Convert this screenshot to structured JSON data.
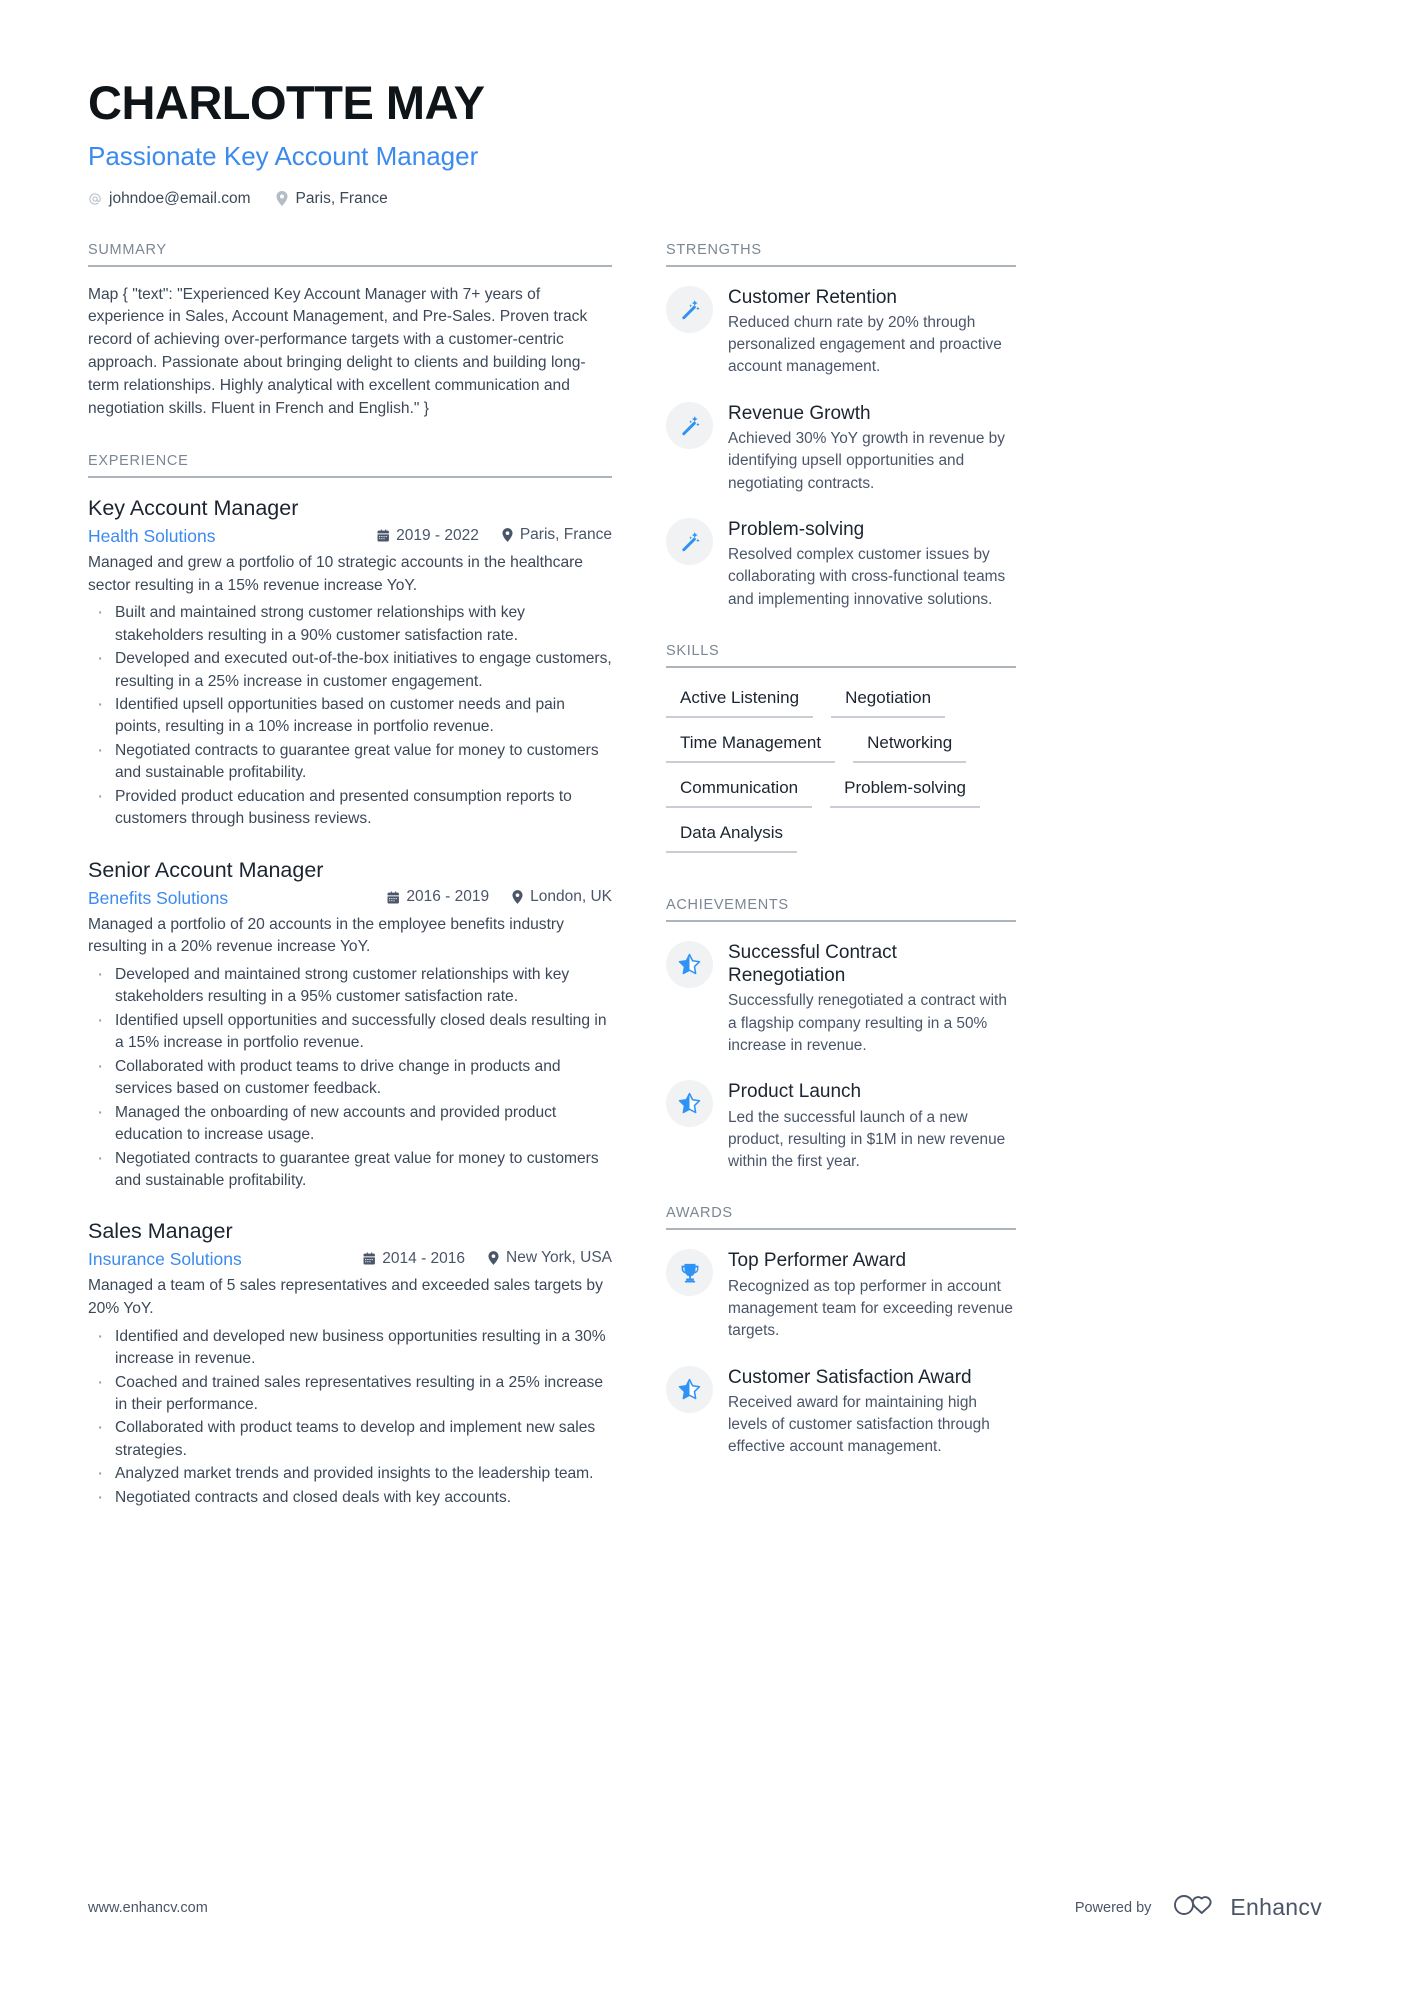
{
  "header": {
    "name": "CHARLOTTE MAY",
    "title": "Passionate Key Account Manager",
    "contacts": [
      {
        "icon": "at-sign-icon",
        "text": "johndoe@email.com"
      },
      {
        "icon": "location-pin-icon",
        "text": "Paris, France"
      }
    ]
  },
  "summary": {
    "heading": "SUMMARY",
    "text": "Map { \"text\": \"Experienced Key Account Manager with 7+ years of experience in Sales, Account Management, and Pre-Sales. Proven track record of achieving over-performance targets with a customer-centric approach. Passionate about bringing delight to clients and building long-term relationships. Highly analytical with excellent communication and negotiation skills. Fluent in French and English.\" }"
  },
  "experience": {
    "heading": "EXPERIENCE",
    "jobs": [
      {
        "title": "Key Account Manager",
        "company": "Health Solutions",
        "date": "2019 - 2022",
        "location": "Paris, France",
        "summary": "Managed and grew a portfolio of 10 strategic accounts in the healthcare sector resulting in a 15% revenue increase YoY.",
        "bullets": [
          "Built and maintained strong customer relationships with key stakeholders resulting in a 90% customer satisfaction rate.",
          "Developed and executed out-of-the-box initiatives to engage customers, resulting in a 25% increase in customer engagement.",
          "Identified upsell opportunities based on customer needs and pain points, resulting in a 10% increase in portfolio revenue.",
          "Negotiated contracts to guarantee great value for money to customers and sustainable profitability.",
          "Provided product education and presented consumption reports to customers through business reviews."
        ]
      },
      {
        "title": "Senior Account Manager",
        "company": "Benefits Solutions",
        "date": "2016 - 2019",
        "location": "London, UK",
        "summary": "Managed a portfolio of 20 accounts in the employee benefits industry resulting in a 20% revenue increase YoY.",
        "bullets": [
          "Developed and maintained strong customer relationships with key stakeholders resulting in a 95% customer satisfaction rate.",
          "Identified upsell opportunities and successfully closed deals resulting in a 15% increase in portfolio revenue.",
          "Collaborated with product teams to drive change in products and services based on customer feedback.",
          "Managed the onboarding of new accounts and provided product education to increase usage.",
          "Negotiated contracts to guarantee great value for money to customers and sustainable profitability."
        ]
      },
      {
        "title": "Sales Manager",
        "company": "Insurance Solutions",
        "date": "2014 - 2016",
        "location": "New York, USA",
        "summary": "Managed a team of 5 sales representatives and exceeded sales targets by 20% YoY.",
        "bullets": [
          "Identified and developed new business opportunities resulting in a 30% increase in revenue.",
          "Coached and trained sales representatives resulting in a 25% increase in their performance.",
          "Collaborated with product teams to develop and implement new sales strategies.",
          "Analyzed market trends and provided insights to the leadership team.",
          "Negotiated contracts and closed deals with key accounts."
        ]
      }
    ]
  },
  "strengths": {
    "heading": "STRENGTHS",
    "items": [
      {
        "icon": "magic-wand-icon",
        "title": "Customer Retention",
        "desc": "Reduced churn rate by 20% through personalized engagement and proactive account management."
      },
      {
        "icon": "magic-wand-icon",
        "title": "Revenue Growth",
        "desc": "Achieved 30% YoY growth in revenue by identifying upsell opportunities and negotiating contracts."
      },
      {
        "icon": "magic-wand-icon",
        "title": "Problem-solving",
        "desc": "Resolved complex customer issues by collaborating with cross-functional teams and implementing innovative solutions."
      }
    ]
  },
  "skills": {
    "heading": "SKILLS",
    "items": [
      "Active Listening",
      "Negotiation",
      "Time Management",
      "Networking",
      "Communication",
      "Problem-solving",
      "Data Analysis"
    ]
  },
  "achievements": {
    "heading": "ACHIEVEMENTS",
    "items": [
      {
        "icon": "half-star-icon",
        "title": "Successful Contract Renegotiation",
        "desc": "Successfully renegotiated a contract with a flagship company resulting in a 50% increase in revenue."
      },
      {
        "icon": "half-star-icon",
        "title": "Product Launch",
        "desc": "Led the successful launch of a new product, resulting in $1M in new revenue within the first year."
      }
    ]
  },
  "awards": {
    "heading": "AWARDS",
    "items": [
      {
        "icon": "trophy-icon",
        "title": "Top Performer Award",
        "desc": "Recognized as top performer in account management team for exceeding revenue targets."
      },
      {
        "icon": "half-star-icon",
        "title": "Customer Satisfaction Award",
        "desc": "Received award for maintaining high levels of customer satisfaction through effective account management."
      }
    ]
  },
  "footer": {
    "url": "www.enhancv.com",
    "powered_by": "Powered by",
    "brand": "Enhancv"
  },
  "colors": {
    "accent_blue": "#3b8aef",
    "icon_blue": "#2f93f5",
    "text_dark": "#1b2430",
    "text_body": "#3c4858",
    "heading_gray": "#7b8794",
    "rule_gray": "#aeb4bb",
    "icon_bg": "#f1f2f3"
  }
}
